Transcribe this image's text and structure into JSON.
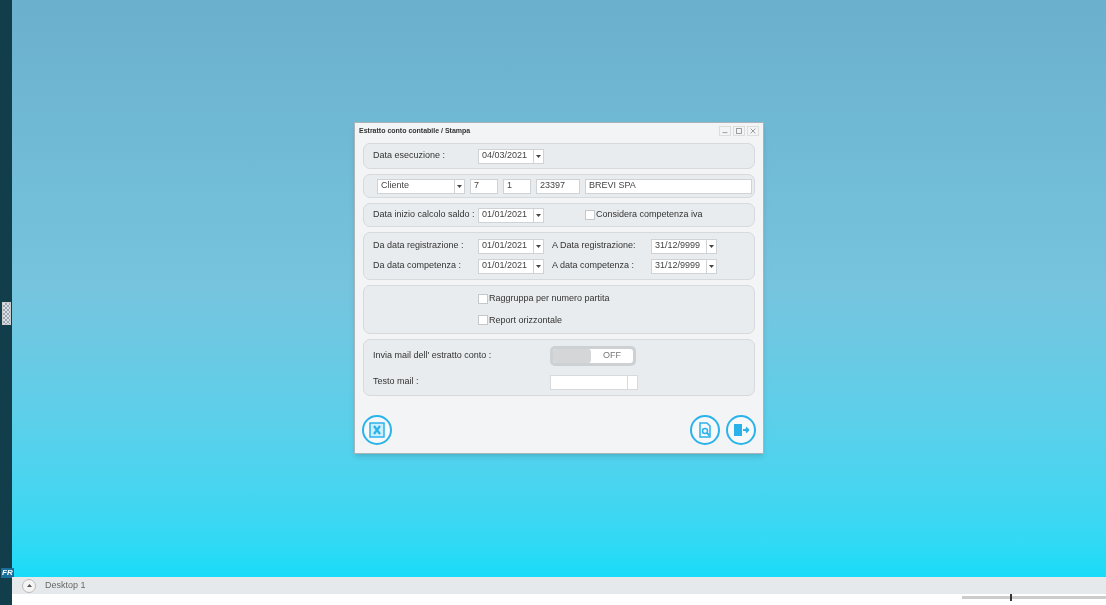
{
  "window": {
    "title": "Estratto conto contabile / Stampa"
  },
  "execution": {
    "label": "Data esecuzione :",
    "value": "04/03/2021"
  },
  "account": {
    "type": "Cliente",
    "code_1": "7",
    "code_2": "1",
    "number": "23397",
    "name": "BREVI SPA"
  },
  "balance": {
    "label": "Data inizio calcolo saldo :",
    "value": "01/01/2021",
    "vat_option": {
      "label": "Considera competenza iva",
      "checked": false
    }
  },
  "ranges": [
    {
      "from_label": "Da data registrazione :",
      "from_value": "01/01/2021",
      "to_label": "A Data registrazione:",
      "to_value": "31/12/9999"
    },
    {
      "from_label": "Da data competenza :",
      "from_value": "01/01/2021",
      "to_label": "A data competenza :",
      "to_value": "31/12/9999"
    }
  ],
  "options": [
    {
      "label": "Raggruppa per numero partita",
      "checked": false
    },
    {
      "label": "Report orizzontale",
      "checked": false
    }
  ],
  "mail": {
    "send_label": "Invia mail dell' estratto conto :",
    "send_on": false,
    "toggle_text": "OFF",
    "text_label": "Testo mail :"
  },
  "side_label": "FR",
  "taskbar": {
    "desktop": "Desktop 1"
  },
  "zoom": {
    "level": 0.33
  }
}
